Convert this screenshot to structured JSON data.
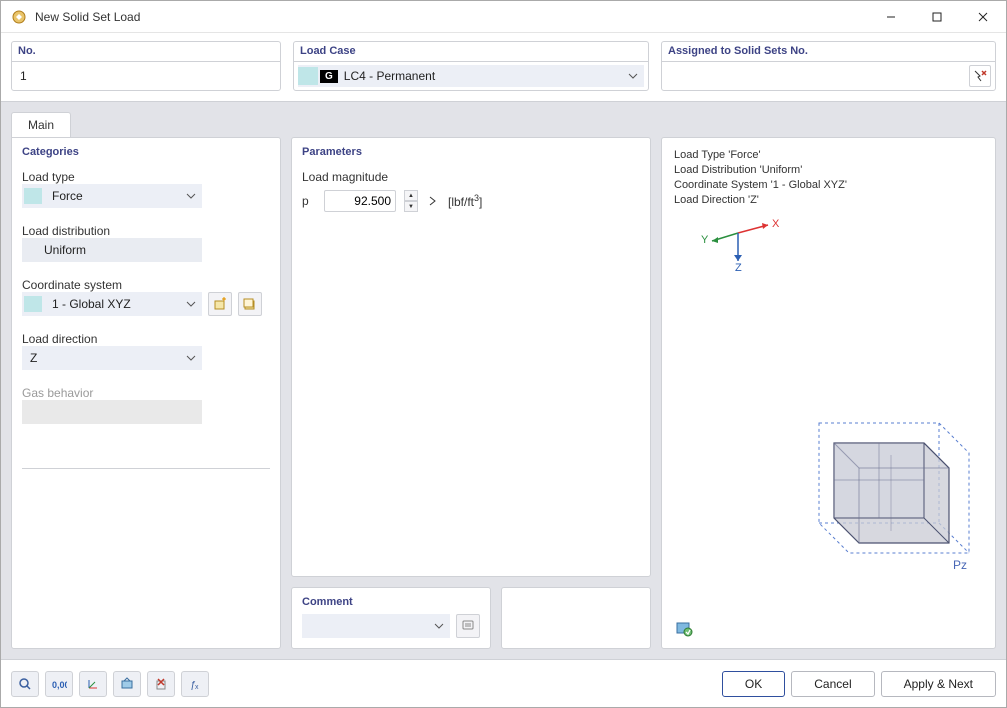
{
  "window": {
    "title": "New Solid Set Load"
  },
  "header": {
    "no_label": "No.",
    "no_value": "1",
    "loadcase_label": "Load Case",
    "loadcase_tag": "G",
    "loadcase_value": "LC4 - Permanent",
    "assigned_label": "Assigned to Solid Sets No.",
    "assigned_value": ""
  },
  "tabs": {
    "main": "Main"
  },
  "categories": {
    "title": "Categories",
    "load_type_label": "Load type",
    "load_type_value": "Force",
    "load_dist_label": "Load distribution",
    "load_dist_value": "Uniform",
    "coord_label": "Coordinate system",
    "coord_value": "1 - Global XYZ",
    "load_dir_label": "Load direction",
    "load_dir_value": "Z",
    "gas_label": "Gas behavior",
    "gas_value": ""
  },
  "parameters": {
    "title": "Parameters",
    "magnitude_label": "Load magnitude",
    "symbol": "p",
    "value": "92.500",
    "unit_prefix": "[lbf/ft",
    "unit_exp": "3",
    "unit_suffix": "]"
  },
  "comment": {
    "title": "Comment",
    "value": ""
  },
  "info": {
    "line1": "Load Type 'Force'",
    "line2": "Load Distribution 'Uniform'",
    "line3": "Coordinate System '1 - Global XYZ'",
    "line4": "Load Direction 'Z'",
    "axis_x": "X",
    "axis_y": "Y",
    "axis_z": "Z",
    "pz": "Pz"
  },
  "footer": {
    "ok": "OK",
    "cancel": "Cancel",
    "apply_next": "Apply & Next"
  }
}
